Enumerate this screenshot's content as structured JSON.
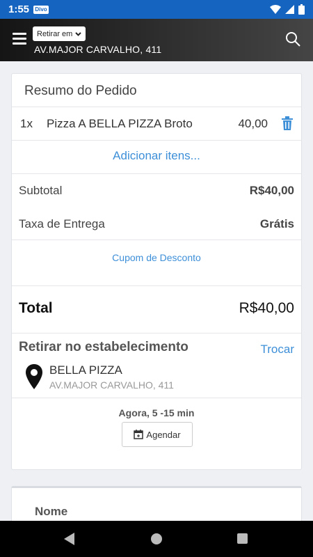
{
  "status_bar": {
    "time": "1:55",
    "badge": "Divo"
  },
  "header": {
    "pickup_select": "Retirar em",
    "address": "AV.MAJOR CARVALHO, 411"
  },
  "order": {
    "title": "Resumo do Pedido",
    "items": [
      {
        "qty": "1x",
        "name": "Pizza A BELLA PIZZA Broto",
        "price": "40,00"
      }
    ],
    "add_items": "Adicionar itens...",
    "subtotal_label": "Subtotal",
    "subtotal_value": "R$40,00",
    "delivery_label": "Taxa de Entrega",
    "delivery_value": "Grátis",
    "coupon": "Cupom de Desconto",
    "total_label": "Total",
    "total_value": "R$40,00"
  },
  "pickup": {
    "title": "Retirar no estabelecimento",
    "change": "Trocar",
    "store_name": "BELLA PIZZA",
    "store_address": "AV.MAJOR CARVALHO, 411",
    "time": "Agora, 5 -15 min",
    "schedule": "Agendar"
  },
  "form": {
    "name_label": "Nome"
  },
  "colors": {
    "accent": "#3d8fd8",
    "status_bar": "#1565c0"
  }
}
